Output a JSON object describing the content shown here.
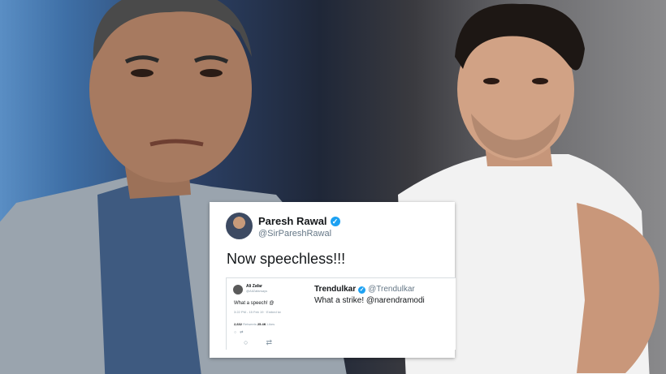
{
  "tweet": {
    "name": "Paresh Rawal",
    "handle": "@SirPareshRawal",
    "text": "Now speechless!!!",
    "verified_mark": "✓",
    "quoted": {
      "name": "Trendulkar",
      "handle": "@Trendulkar",
      "text": "What a strike! @narendramodi",
      "image": {
        "name": "Ali Zafar",
        "handle": "@AliZafarsays",
        "text": "What a speech! @",
        "time": "3:22 PM - 15 Feb 19 · Embed tw",
        "retweets": "2,632",
        "retweets_label": "Retweets",
        "likes": "25.4K",
        "likes_label": "Likes"
      }
    }
  },
  "icons": {
    "reply": "reply-icon",
    "retweet": "retweet-icon",
    "verified": "verified-badge-icon"
  },
  "colors": {
    "verified_blue": "#1da1f2",
    "text_dark": "#14171a",
    "text_gray": "#657786"
  }
}
